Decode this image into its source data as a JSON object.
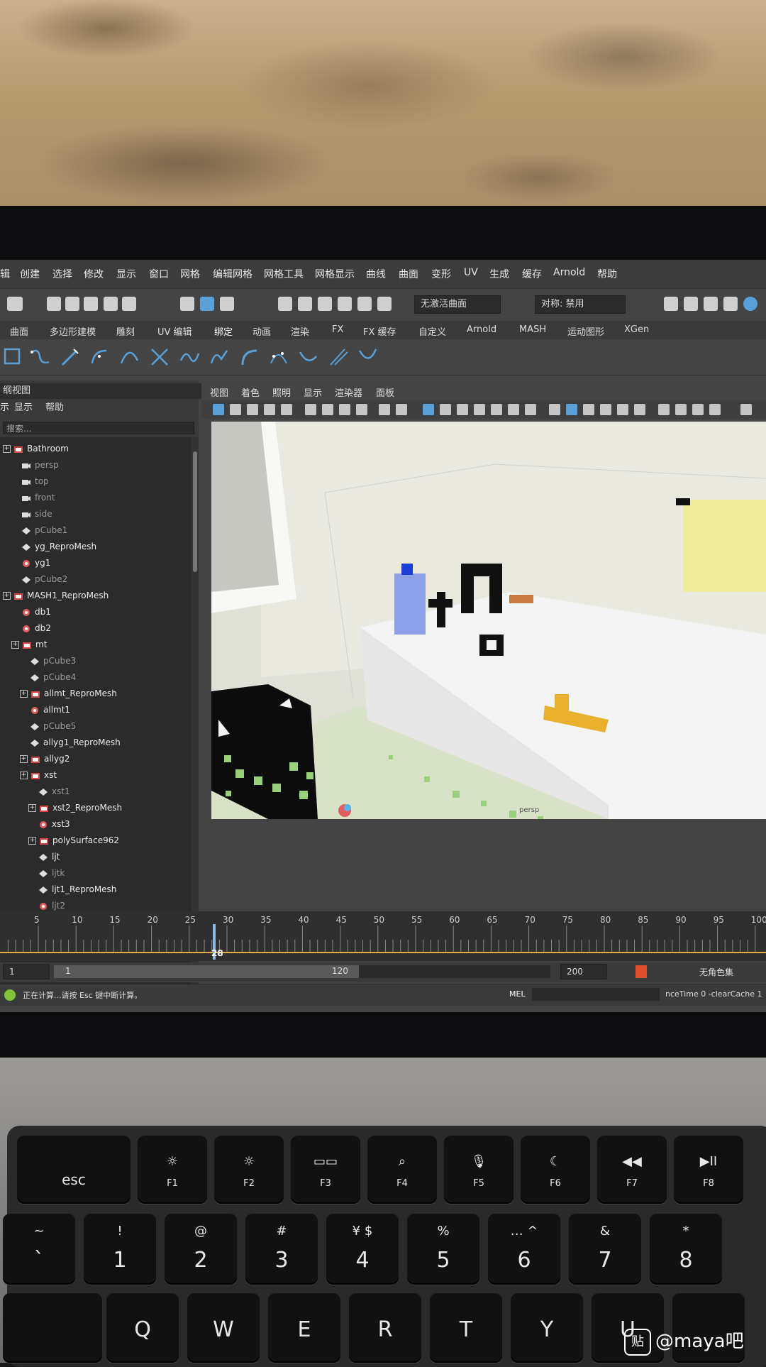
{
  "menu": [
    "辑",
    "创建",
    "选择",
    "修改",
    "显示",
    "窗口",
    "网格",
    "编辑网格",
    "网格工具",
    "网格显示",
    "曲线",
    "曲面",
    "变形",
    "UV",
    "生成",
    "缓存",
    "Arnold",
    "帮助"
  ],
  "toolbar": {
    "field_live": "无激活曲面",
    "field_symmetry": "对称: 禁用"
  },
  "shelf_tabs": [
    "曲面",
    "多边形建模",
    "雕刻",
    "UV 编辑",
    "绑定",
    "动画",
    "渲染",
    "FX",
    "FX 缓存",
    "自定义",
    "Arnold",
    "MASH",
    "运动图形",
    "XGen"
  ],
  "shelf_active_tab": "绑定",
  "outliner": {
    "title": "纲视图",
    "menu": [
      "示",
      "显示",
      "帮助"
    ],
    "search_placeholder": "搜索...",
    "nodes": [
      {
        "label": "Bathroom",
        "indent": 0,
        "icon": "group",
        "exp": "+"
      },
      {
        "label": "persp",
        "indent": 1,
        "icon": "camera",
        "dim": true
      },
      {
        "label": "top",
        "indent": 1,
        "icon": "camera",
        "dim": true
      },
      {
        "label": "front",
        "indent": 1,
        "icon": "camera",
        "dim": true
      },
      {
        "label": "side",
        "indent": 1,
        "icon": "camera",
        "dim": true
      },
      {
        "label": "pCube1",
        "indent": 1,
        "icon": "mesh",
        "dim": true
      },
      {
        "label": "yg_ReproMesh",
        "indent": 1,
        "icon": "mesh"
      },
      {
        "label": "yg1",
        "indent": 1,
        "icon": "mash"
      },
      {
        "label": "pCube2",
        "indent": 1,
        "icon": "mesh",
        "dim": true
      },
      {
        "label": "MASH1_ReproMesh",
        "indent": 0,
        "icon": "group",
        "exp": "+"
      },
      {
        "label": "db1",
        "indent": 1,
        "icon": "mash"
      },
      {
        "label": "db2",
        "indent": 1,
        "icon": "mash"
      },
      {
        "label": "mt",
        "indent": 1,
        "icon": "group",
        "exp": "+"
      },
      {
        "label": "pCube3",
        "indent": 2,
        "icon": "mesh",
        "dim": true
      },
      {
        "label": "pCube4",
        "indent": 2,
        "icon": "mesh",
        "dim": true
      },
      {
        "label": "allmt_ReproMesh",
        "indent": 2,
        "icon": "group",
        "exp": "+"
      },
      {
        "label": "allmt1",
        "indent": 2,
        "icon": "mash"
      },
      {
        "label": "pCube5",
        "indent": 2,
        "icon": "mesh",
        "dim": true
      },
      {
        "label": "allyg1_ReproMesh",
        "indent": 2,
        "icon": "mesh"
      },
      {
        "label": "allyg2",
        "indent": 2,
        "icon": "group",
        "exp": "+"
      },
      {
        "label": "xst",
        "indent": 2,
        "icon": "group",
        "exp": "+"
      },
      {
        "label": "xst1",
        "indent": 3,
        "icon": "mesh",
        "dim": true
      },
      {
        "label": "xst2_ReproMesh",
        "indent": 3,
        "icon": "group",
        "exp": "+"
      },
      {
        "label": "xst3",
        "indent": 3,
        "icon": "mash"
      },
      {
        "label": "polySurface962",
        "indent": 3,
        "icon": "group",
        "exp": "+"
      },
      {
        "label": "ljt",
        "indent": 3,
        "icon": "mesh"
      },
      {
        "label": "ljtk",
        "indent": 3,
        "icon": "mesh",
        "dim": true
      },
      {
        "label": "ljt1_ReproMesh",
        "indent": 3,
        "icon": "mesh"
      },
      {
        "label": "ljt2",
        "indent": 3,
        "icon": "mash",
        "dim": true
      }
    ]
  },
  "viewport": {
    "menu": [
      "视图",
      "着色",
      "照明",
      "显示",
      "渲染器",
      "面板"
    ],
    "camera_label": "persp"
  },
  "timeline": {
    "ticks": [
      "5",
      "10",
      "15",
      "20",
      "25",
      "30",
      "35",
      "40",
      "45",
      "50",
      "55",
      "60",
      "65",
      "70",
      "75",
      "80",
      "85",
      "90",
      "95",
      "100"
    ],
    "current_frame": "28"
  },
  "range": {
    "start": "1",
    "inner_start": "1",
    "inner_end": "120",
    "end": "200",
    "character_set": "无角色集"
  },
  "status": {
    "message": "正在计算...请按 Esc 键中断计算。",
    "mel_label": "MEL",
    "command": "nceTime 0 -clearCache 1"
  },
  "keyboard": {
    "fn_row": [
      {
        "main": "esc",
        "sub": ""
      },
      {
        "main": "☼",
        "sub": "F1"
      },
      {
        "main": "☼",
        "sub": "F2"
      },
      {
        "main": "▭▭",
        "sub": "F3"
      },
      {
        "main": "⌕",
        "sub": "F4"
      },
      {
        "main": "🎙",
        "sub": "F5"
      },
      {
        "main": "☾",
        "sub": "F6"
      },
      {
        "main": "◀◀",
        "sub": "F7"
      },
      {
        "main": "▶II",
        "sub": "F8"
      }
    ],
    "num_row": [
      {
        "top": "~",
        "main": "`"
      },
      {
        "top": "!",
        "main": "1"
      },
      {
        "top": "@",
        "main": "2"
      },
      {
        "top": "#",
        "main": "3"
      },
      {
        "top": "¥  $",
        "main": "4"
      },
      {
        "top": "%",
        "main": "5"
      },
      {
        "top": "…  ^",
        "main": "6"
      },
      {
        "top": "&",
        "main": "7"
      },
      {
        "top": "*",
        "main": "8"
      }
    ],
    "letter_row": [
      "",
      "Q",
      "W",
      "E",
      "R",
      "T",
      "Y",
      "U",
      ""
    ]
  },
  "watermark": {
    "logo": "贴",
    "text": "@maya吧"
  },
  "colors": {
    "ui_dark": "#444444",
    "accent_blue": "#5aa0d8",
    "scene_floor": "#d7e2c8",
    "scene_tub": "#f4f4f4",
    "towel": "#ecec9a",
    "bottle": "#8ea1e8",
    "duck": "#e8b02c"
  }
}
